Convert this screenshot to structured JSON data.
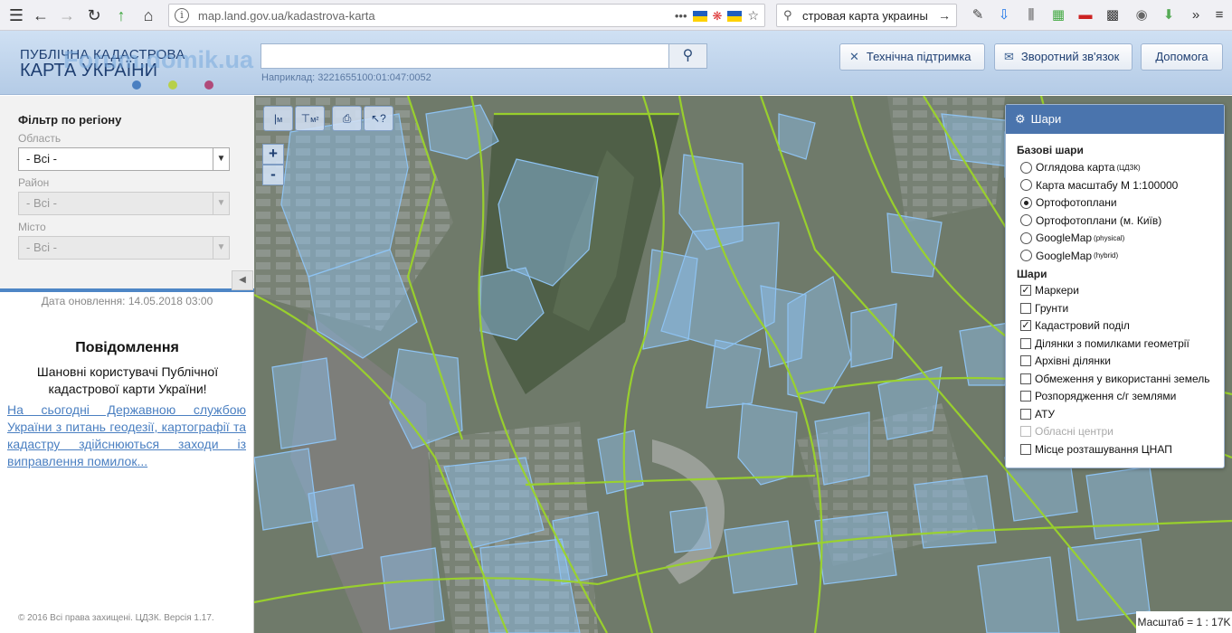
{
  "browser": {
    "url": "map.land.gov.ua/kadastrova-karta",
    "search_text": "стровая карта украины",
    "search_arrow": "→"
  },
  "header": {
    "logo_line1": "ПУБЛІЧНА КАДАСТРОВА",
    "logo_line2": "КАРТА УКРАЇНИ",
    "watermark": "Forum.domik.ua",
    "search_placeholder": "",
    "search_hint": "Наприклад: 3221655100:01:047:0052",
    "buttons": {
      "support": "Технічна підтримка",
      "feedback": "Зворотний зв'язок",
      "help": "Допомога"
    }
  },
  "sidebar": {
    "filter_title": "Фільтр по регіону",
    "oblast_label": "Область",
    "oblast_value": "- Всі -",
    "rayon_label": "Район",
    "rayon_value": "- Всі -",
    "city_label": "Місто",
    "city_value": "- Всі -",
    "update_date": "Дата оновлення: 14.05.2018 03:00",
    "message_title": "Повідомлення",
    "message_body": "Шановні користувачі Публічної кадастрової карти України!",
    "message_link": "На сьогодні Державною службою України з питань геодезії, картографії та кадастру здійснюються заходи із виправлення помилок...",
    "copyright": "© 2016 Всі права захищені. ЦДЗК. Версія 1.17."
  },
  "map": {
    "tools": [
      "M",
      "M²",
      "print",
      "info"
    ],
    "tool_labels": {
      "measure_line": "м",
      "measure_area": "м²"
    },
    "zoom_in": "+",
    "zoom_out": "-",
    "scale": "Масштаб = 1 : 17K"
  },
  "layers": {
    "title": "Шари",
    "base_title": "Базові шари",
    "base": [
      {
        "label": "Оглядова карта",
        "sup": "(ЦДЗК)",
        "selected": false
      },
      {
        "label": "Карта масштабу М 1:100000",
        "sup": "",
        "selected": false
      },
      {
        "label": "Ортофотоплани",
        "sup": "",
        "selected": true
      },
      {
        "label": "Ортофотоплани (м. Київ)",
        "sup": "",
        "selected": false
      },
      {
        "label": "GoogleMap",
        "sup": "(physical)",
        "selected": false
      },
      {
        "label": "GoogleMap",
        "sup": "(hybrid)",
        "selected": false
      }
    ],
    "overlay_title": "Шари",
    "overlays": [
      {
        "label": "Маркери",
        "checked": true,
        "disabled": false
      },
      {
        "label": "Грунти",
        "checked": false,
        "disabled": false
      },
      {
        "label": "Кадастровий поділ",
        "checked": true,
        "disabled": false
      },
      {
        "label": "Ділянки з помилками геометрії",
        "checked": false,
        "disabled": false
      },
      {
        "label": "Архівні ділянки",
        "checked": false,
        "disabled": false
      },
      {
        "label": "Обмеження у використанні земель",
        "checked": false,
        "disabled": false
      },
      {
        "label": "Розпорядження с/г землями",
        "checked": false,
        "disabled": false
      },
      {
        "label": "АТУ",
        "checked": false,
        "disabled": false
      },
      {
        "label": "Обласні центри",
        "checked": false,
        "disabled": true
      },
      {
        "label": "Місце розташування ЦНАП",
        "checked": false,
        "disabled": false
      }
    ]
  },
  "colors": {
    "header_blue": "#b4cbe6",
    "accent": "#4a74ad",
    "parcel_fill": "#8ec0ef",
    "road_green": "#9bd42a"
  }
}
